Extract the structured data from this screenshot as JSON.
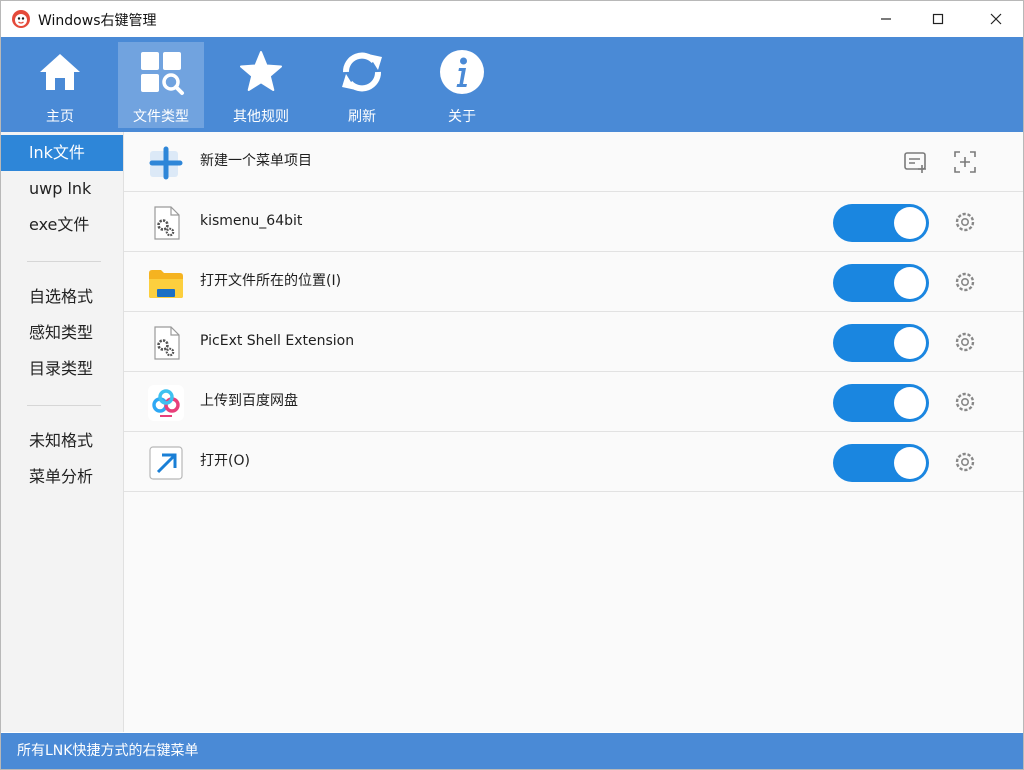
{
  "window": {
    "title": "Windows右键管理"
  },
  "toolbar": {
    "tabs": [
      {
        "label": "主页",
        "icon": "home-icon"
      },
      {
        "label": "文件类型",
        "icon": "file-types-icon",
        "active": true
      },
      {
        "label": "其他规则",
        "icon": "star-icon"
      },
      {
        "label": "刷新",
        "icon": "refresh-icon"
      },
      {
        "label": "关于",
        "icon": "info-icon"
      }
    ]
  },
  "sidebar": {
    "groups": [
      [
        {
          "label": "lnk文件",
          "active": true
        },
        {
          "label": "uwp lnk"
        },
        {
          "label": "exe文件"
        }
      ],
      [
        {
          "label": "自选格式"
        },
        {
          "label": "感知类型"
        },
        {
          "label": "目录类型"
        }
      ],
      [
        {
          "label": "未知格式"
        },
        {
          "label": "菜单分析"
        }
      ]
    ]
  },
  "content": {
    "new_item_label": "新建一个菜单项目",
    "items": [
      {
        "label": "kismenu_64bit",
        "icon": "gear-file-icon",
        "enabled": true
      },
      {
        "label": "打开文件所在的位置(I)",
        "icon": "folder-icon",
        "enabled": true
      },
      {
        "label": "PicExt Shell Extension",
        "icon": "gear-file-icon",
        "enabled": true
      },
      {
        "label": "上传到百度网盘",
        "icon": "baidu-netdisk-icon",
        "enabled": true
      },
      {
        "label": "打开(O)",
        "icon": "open-arrow-icon",
        "enabled": true
      }
    ]
  },
  "statusbar": {
    "text": "所有LNK快捷方式的右键菜单"
  },
  "colors": {
    "accent": "#4a8ad6",
    "toggle_on": "#1a86e0",
    "sidebar_active": "#2e86d8"
  }
}
